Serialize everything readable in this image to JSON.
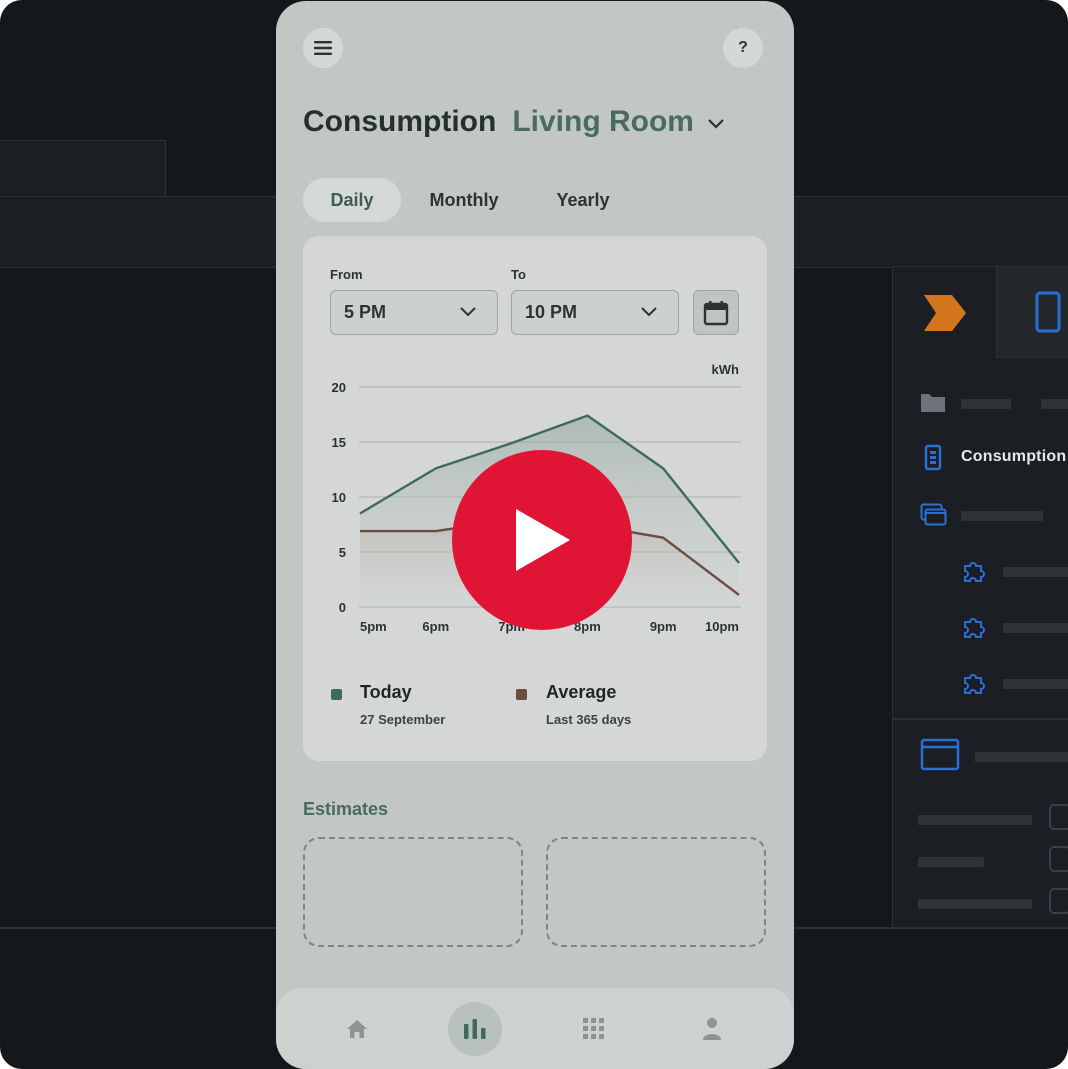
{
  "header": {
    "page_title": "Consumption",
    "room": "Living Room",
    "help_label": "?"
  },
  "tabs": [
    {
      "label": "Daily",
      "selected": true
    },
    {
      "label": "Monthly",
      "selected": false
    },
    {
      "label": "Yearly",
      "selected": false
    }
  ],
  "filters": {
    "from_label": "From",
    "from_value": "5 PM",
    "to_label": "To",
    "to_value": "10 PM"
  },
  "chart_data": {
    "type": "line",
    "ylabel": "kWh",
    "x": [
      "5pm",
      "6pm",
      "7pm",
      "8pm",
      "9pm",
      "10pm"
    ],
    "yticks": [
      0,
      5,
      10,
      15,
      20
    ],
    "ylim": [
      0,
      20
    ],
    "series": [
      {
        "name": "Today",
        "color": "#3e6b5e",
        "values": [
          8.5,
          12.6,
          14.9,
          17.4,
          12.6,
          4.0
        ]
      },
      {
        "name": "Average",
        "color": "#6b4c3f",
        "values": [
          6.9,
          6.9,
          7.9,
          7.5,
          6.3,
          1.1
        ]
      }
    ],
    "legend": [
      {
        "name": "Today",
        "detail": "27 September",
        "color": "#3e6b5e"
      },
      {
        "name": "Average",
        "detail": "Last 365 days",
        "color": "#6b4c3f"
      }
    ],
    "grid": true
  },
  "estimates": {
    "title": "Estimates"
  },
  "sidebar": {
    "active_item": "Consumption"
  },
  "nav": {
    "items": [
      "home-icon",
      "stats-icon",
      "apps-icon",
      "profile-icon"
    ],
    "active": "stats-icon"
  },
  "colors": {
    "accent": "#4a6b62",
    "play": "#e01536",
    "brand_orange": "#d4761c",
    "ide_blue": "#2a6fd6"
  }
}
